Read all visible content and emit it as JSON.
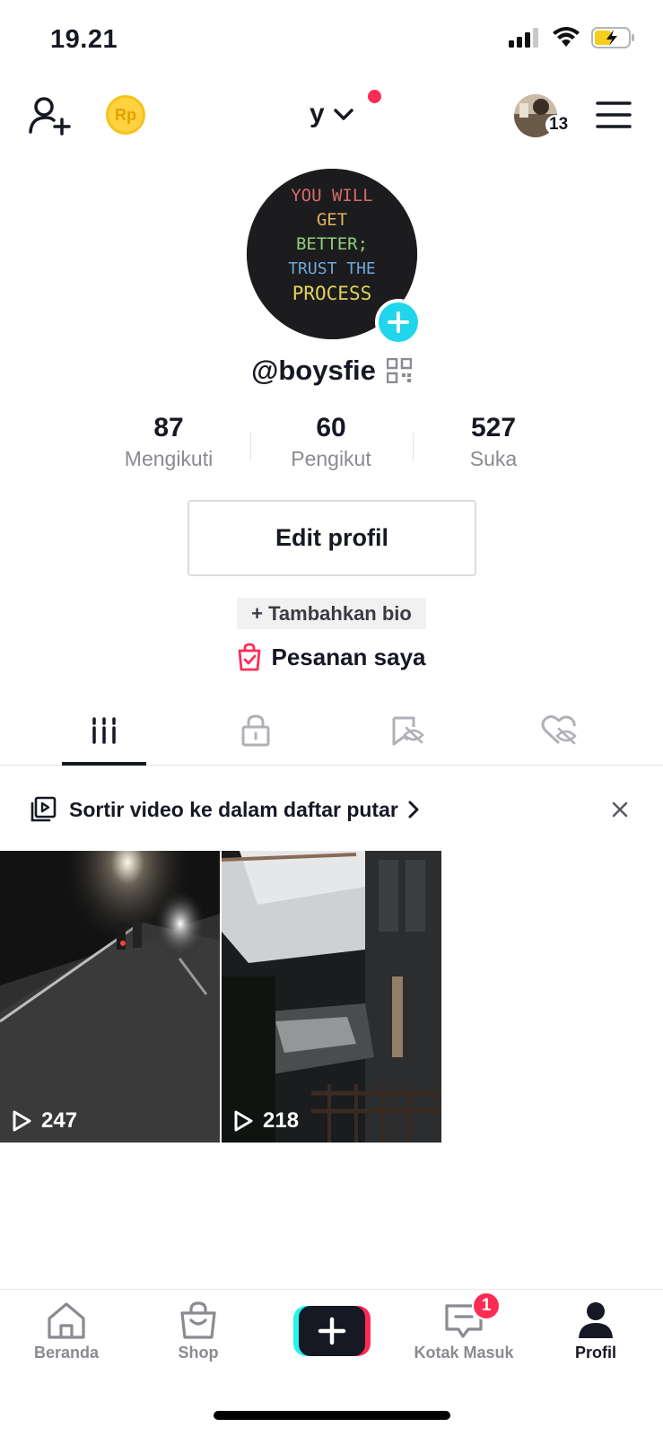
{
  "status_bar": {
    "time": "19.21"
  },
  "header": {
    "coin_label": "Rp",
    "username_short": "y",
    "friends_count": "13"
  },
  "profile": {
    "avatar_text": [
      "YOU WILL",
      "GET",
      "BETTER;",
      "TRUST THE",
      "PROCESS"
    ],
    "handle": "@boysfie",
    "stats": [
      {
        "value": "87",
        "label": "Mengikuti"
      },
      {
        "value": "60",
        "label": "Pengikut"
      },
      {
        "value": "527",
        "label": "Suka"
      }
    ],
    "edit_label": "Edit profil",
    "bio_label": "+ Tambahkan bio",
    "orders_label": "Pesanan saya"
  },
  "tabs": [
    {
      "icon": "grid-icon",
      "active": true
    },
    {
      "icon": "lock-icon",
      "active": false
    },
    {
      "icon": "hidden-bookmark-icon",
      "active": false
    },
    {
      "icon": "hidden-heart-icon",
      "active": false
    }
  ],
  "sort_banner": {
    "text": "Sortir video ke dalam daftar putar"
  },
  "videos": [
    {
      "views": "247"
    },
    {
      "views": "218"
    }
  ],
  "bottom_nav": {
    "items": [
      {
        "label": "Beranda",
        "icon": "home-icon"
      },
      {
        "label": "Shop",
        "icon": "shop-bag-icon"
      },
      {
        "label": "",
        "icon": "plus-icon"
      },
      {
        "label": "Kotak Masuk",
        "icon": "inbox-icon"
      },
      {
        "label": "Profil",
        "icon": "person-icon"
      }
    ],
    "inbox_badge": "1"
  },
  "colors": {
    "accent_red": "#FE2C55",
    "accent_cyan": "#20D5EC",
    "text_primary": "#161823",
    "text_secondary": "#8a8b91"
  }
}
